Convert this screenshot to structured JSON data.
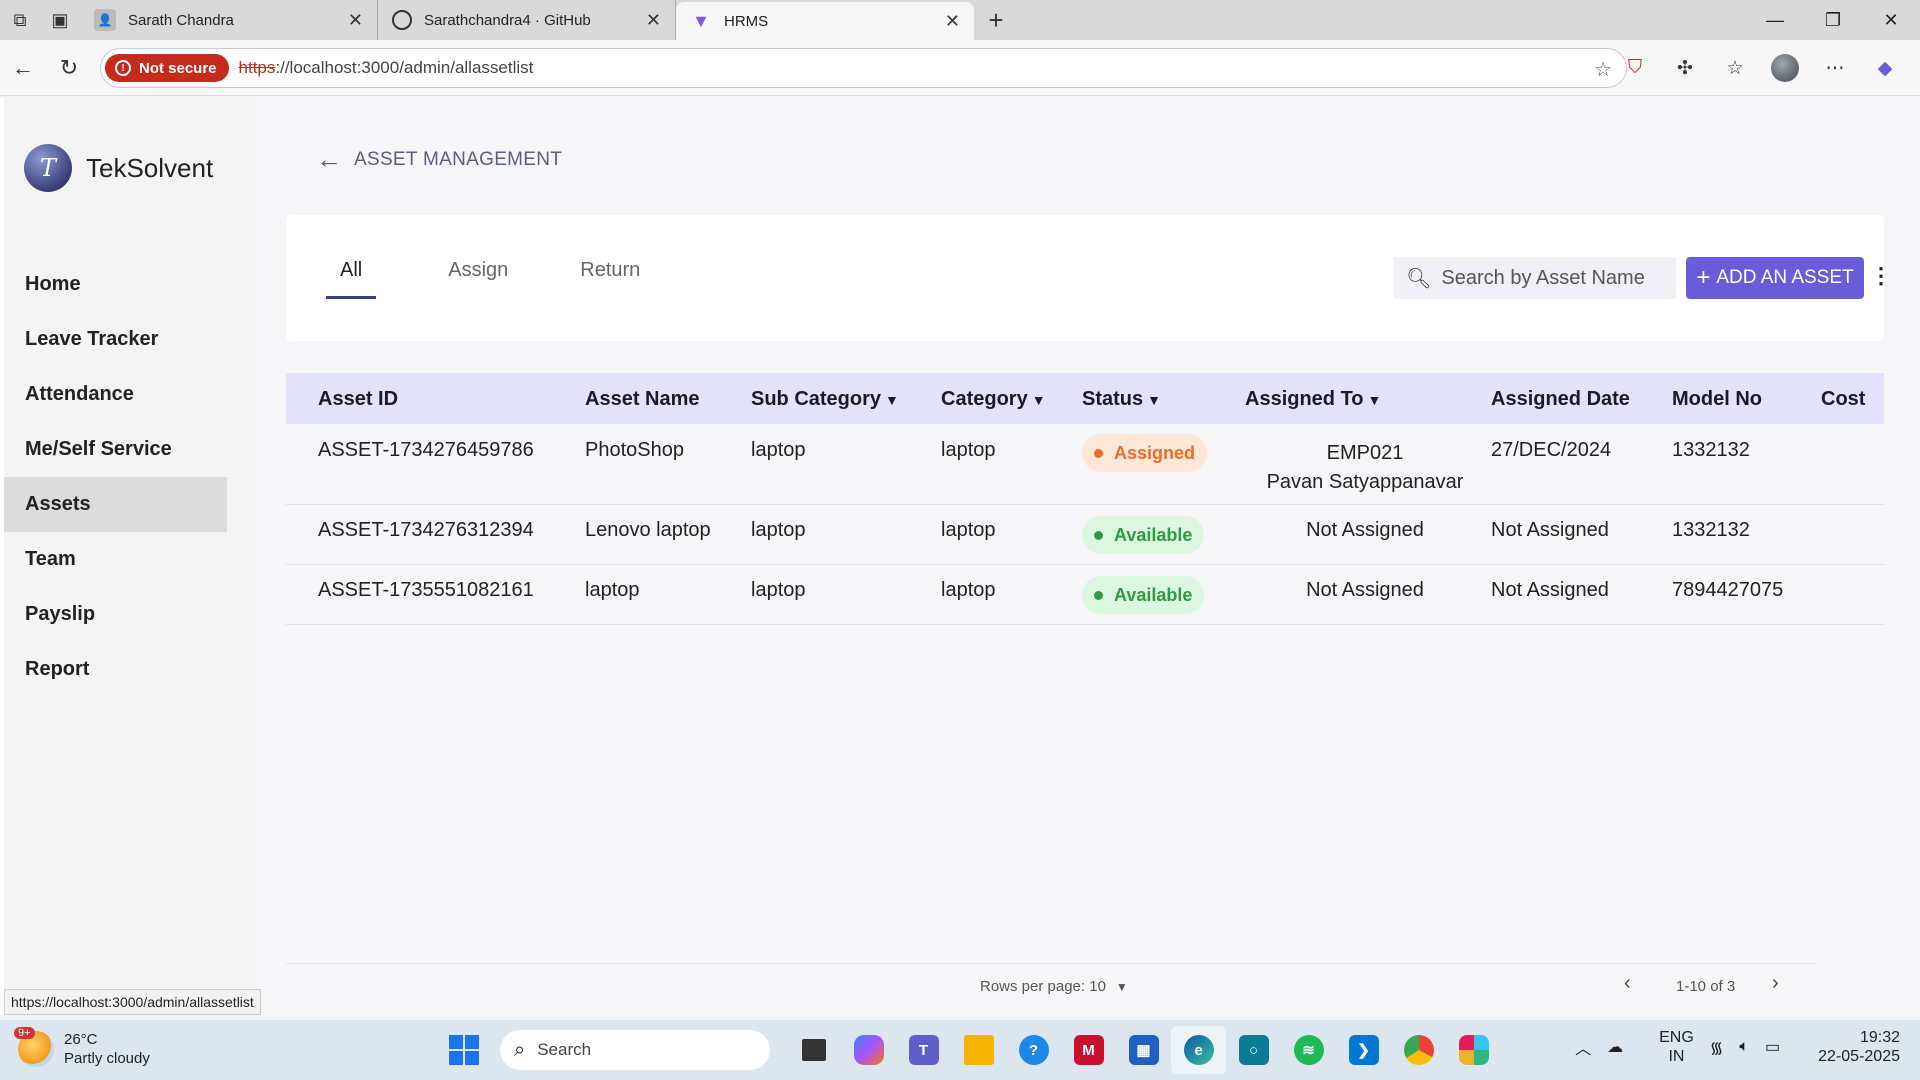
{
  "browser": {
    "tabs": [
      {
        "title": "Sarath Chandra",
        "active": false
      },
      {
        "title": "Sarathchandra4 · GitHub",
        "active": false
      },
      {
        "title": "HRMS",
        "active": true
      }
    ],
    "not_secure_label": "Not secure",
    "url_protocol": "https",
    "url_rest": "://localhost:3000/admin/allassetlist",
    "status_url": "https://localhost:3000/admin/allassetlist"
  },
  "sidebar": {
    "brand": "TekSolvent",
    "items": [
      {
        "label": "Home"
      },
      {
        "label": "Leave Tracker"
      },
      {
        "label": "Attendance"
      },
      {
        "label": "Me/Self Service"
      },
      {
        "label": "Assets",
        "active": true
      },
      {
        "label": "Team"
      },
      {
        "label": "Payslip"
      },
      {
        "label": "Report"
      }
    ]
  },
  "header": {
    "title": "ASSET MANAGEMENT"
  },
  "tabs": [
    {
      "label": "All",
      "selected": true
    },
    {
      "label": "Assign"
    },
    {
      "label": "Return"
    }
  ],
  "search": {
    "placeholder": "Search by Asset Name",
    "value": ""
  },
  "add_button": "ADD AN ASSET",
  "table": {
    "columns": [
      "Asset ID",
      "Asset Name",
      "Sub Category",
      "Category",
      "Status",
      "Assigned To",
      "Assigned Date",
      "Model No",
      "Cost"
    ],
    "rows": [
      {
        "asset_id": "ASSET-1734276459786",
        "asset_name": "PhotoShop",
        "sub_category": "laptop",
        "category": "laptop",
        "status": "Assigned",
        "assigned_to": "EMP021",
        "assigned_to_name": "Pavan Satyappanavar",
        "assigned_date": "27/DEC/2024",
        "model_no": "1332132",
        "cost": ""
      },
      {
        "asset_id": "ASSET-1734276312394",
        "asset_name": "Lenovo laptop",
        "sub_category": "laptop",
        "category": "laptop",
        "status": "Available",
        "assigned_to": "Not Assigned",
        "assigned_to_name": "",
        "assigned_date": "Not Assigned",
        "model_no": "1332132",
        "cost": ""
      },
      {
        "asset_id": "ASSET-1735551082161",
        "asset_name": "laptop",
        "sub_category": "laptop",
        "category": "laptop",
        "status": "Available",
        "assigned_to": "Not Assigned",
        "assigned_to_name": "",
        "assigned_date": "Not Assigned",
        "model_no": "7894427075",
        "cost": ""
      }
    ]
  },
  "pagination": {
    "rows_per_page_label": "Rows per page: 10",
    "range": "1-10 of 3"
  },
  "taskbar": {
    "weather_temp": "26°C",
    "weather_desc": "Partly cloudy",
    "weather_badge": "9+",
    "search_label": "Search",
    "lang_line1": "ENG",
    "lang_line2": "IN",
    "time": "19:32",
    "date": "22-05-2025"
  },
  "colors": {
    "accent": "#6a5bd8",
    "header_row": "#e4e1fb",
    "assigned": "#f16b24",
    "available": "#2e9b45",
    "not_secure": "#c42b1c"
  }
}
